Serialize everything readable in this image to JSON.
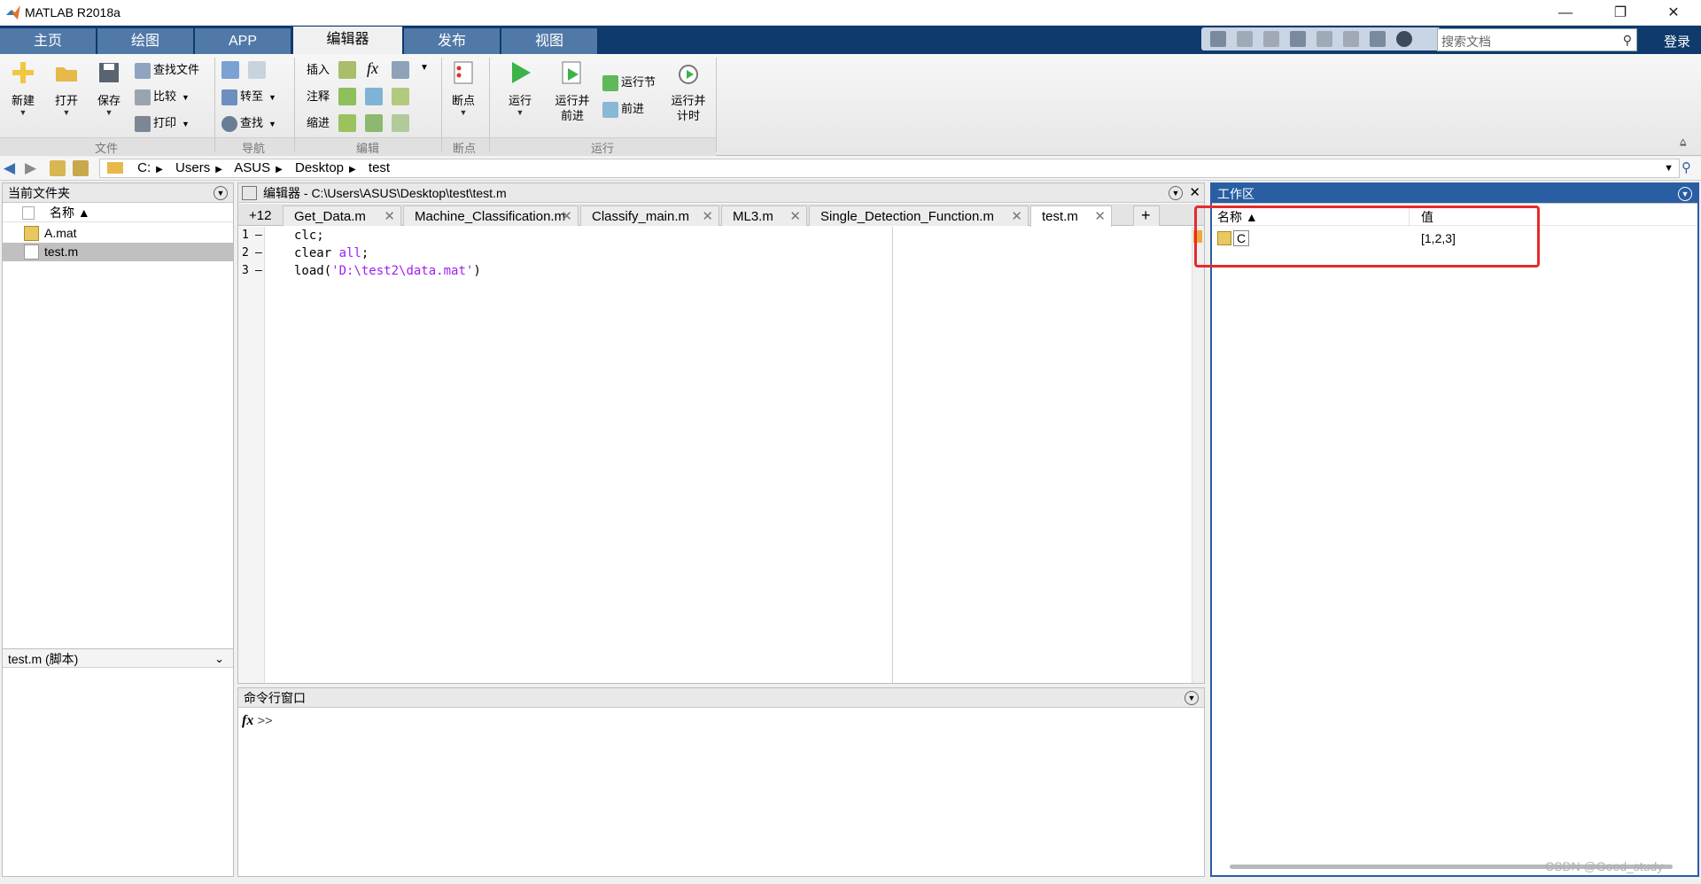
{
  "window": {
    "title": "MATLAB R2018a",
    "minimize": "—",
    "restore": "❐",
    "close": "✕"
  },
  "tabs": [
    "主页",
    "绘图",
    "APP",
    "编辑器",
    "发布",
    "视图"
  ],
  "search": {
    "placeholder": "搜索文档"
  },
  "login": "登录",
  "ribbon": {
    "file": {
      "new": "新建",
      "open": "打开",
      "save": "保存",
      "find_files": "查找文件",
      "compare": "比较",
      "print": "打印",
      "label": "文件"
    },
    "nav": {
      "goto": "转至",
      "find": "查找",
      "label": "导航"
    },
    "edit": {
      "insert": "插入",
      "comment": "注释",
      "indent": "缩进",
      "label": "编辑"
    },
    "breakpoints": {
      "btn": "断点",
      "label": "断点"
    },
    "run": {
      "run": "运行",
      "run_advance_1": "运行并",
      "run_advance_2": "前进",
      "run_section": "运行节",
      "advance": "前进",
      "run_time_1": "运行并",
      "run_time_2": "计时",
      "label": "运行"
    }
  },
  "address": [
    "C:",
    "Users",
    "ASUS",
    "Desktop",
    "test"
  ],
  "current_folder": {
    "title": "当前文件夹",
    "col_name": "名称 ▲",
    "files": [
      {
        "name": "A.mat",
        "type": "mat"
      },
      {
        "name": "test.m",
        "type": "m",
        "selected": true
      }
    ],
    "details": "test.m (脚本)"
  },
  "editor": {
    "title": "编辑器 - C:\\Users\\ASUS\\Desktop\\test\\test.m",
    "overflow": "+12",
    "tabs": [
      "Get_Data.m",
      "Machine_Classification.m",
      "Classify_main.m",
      "ML3.m",
      "Single_Detection_Function.m",
      "test.m"
    ],
    "active_tab": "test.m",
    "add_tab": "+",
    "lines": [
      {
        "num": "1",
        "mark": "–",
        "code": "clc;"
      },
      {
        "num": "2",
        "mark": "–",
        "code_a": "clear ",
        "code_kw": "all",
        "code_b": ";"
      },
      {
        "num": "3",
        "mark": "–",
        "code_a": "load(",
        "code_str": "'D:\\test2\\data.mat'",
        "code_b": ")"
      }
    ]
  },
  "command_window": {
    "title": "命令行窗口",
    "fx": "fx",
    "prompt": ">>"
  },
  "workspace": {
    "title": "工作区",
    "col_name": "名称 ▲",
    "col_value": "值",
    "vars": [
      {
        "name": "C",
        "value": "[1,2,3]"
      }
    ]
  },
  "watermark": "CSDN @Good_study",
  "colors": {
    "tabstrip": "#0e3a6d",
    "tab": "#5179a8",
    "workspace_border": "#2a5ea3",
    "highlight": "#e52b2b"
  }
}
